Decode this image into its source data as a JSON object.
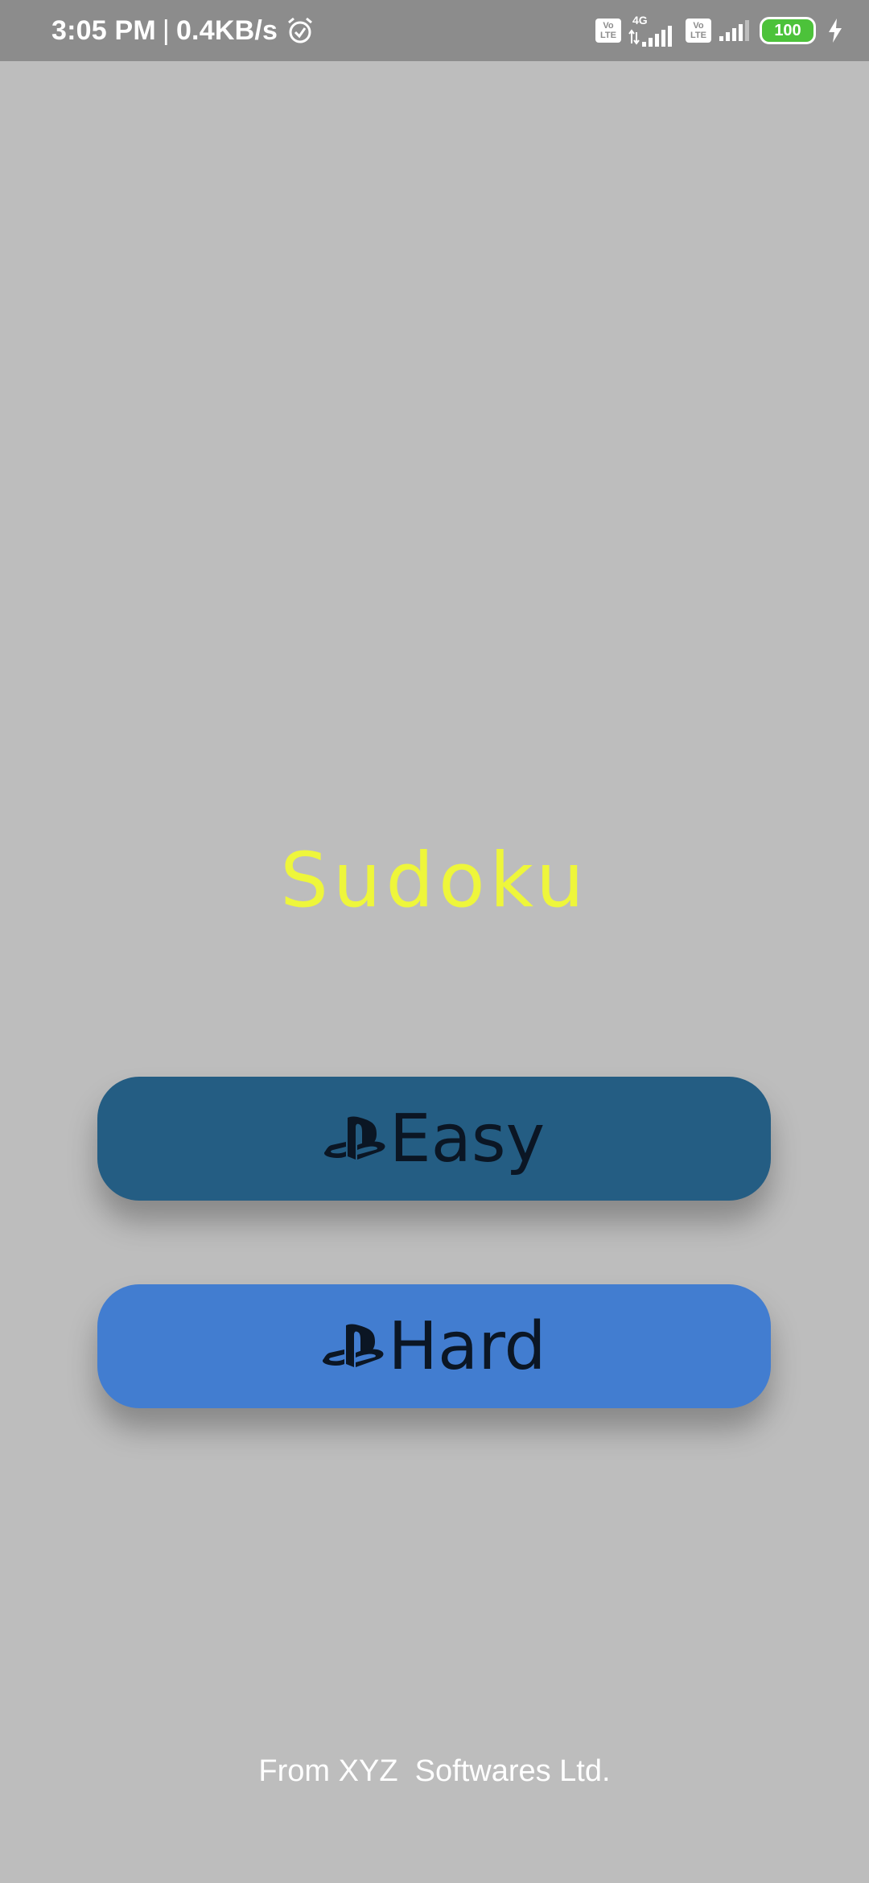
{
  "status_bar": {
    "time": "3:05 PM",
    "separator": "|",
    "speed": "0.4KB/s",
    "volte1_top": "Vo",
    "volte1_bottom": "LTE",
    "network_type": "4G",
    "volte2_top": "Vo",
    "volte2_bottom": "LTE",
    "battery_level": "100",
    "icons": [
      "alarm-icon",
      "signal-icon",
      "battery-icon",
      "charging-bolt-icon"
    ]
  },
  "app": {
    "title": "Sudoku",
    "buttons": {
      "easy_label": "Easy",
      "hard_label": "Hard"
    },
    "footer": "From XYZ  Softwares Ltd."
  },
  "colors": {
    "background": "#bdbdbd",
    "status_bar": "#8c8c8c",
    "title": "#eef63b",
    "easy_button": "#245d83",
    "hard_button": "#427dd0",
    "button_text": "#0b1624",
    "battery": "#4cc23a"
  }
}
